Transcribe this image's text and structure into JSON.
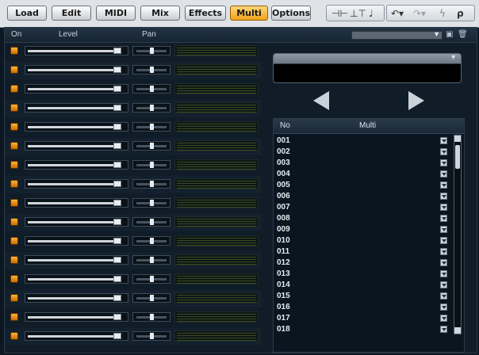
{
  "toolbar": {
    "tabs": [
      {
        "label": "Load"
      },
      {
        "label": "Edit"
      },
      {
        "label": "MIDI"
      },
      {
        "label": "Mix"
      },
      {
        "label": "Effects"
      },
      {
        "label": "Multi",
        "active": true
      },
      {
        "label": "Options"
      }
    ],
    "icons": [
      "split-icon",
      "merge-icon",
      "note-icon",
      "undo-icon",
      "redo-icon",
      "flash-icon",
      "pin-icon"
    ]
  },
  "mixer": {
    "headers": {
      "on": "On",
      "level": "Level",
      "pan": "Pan"
    },
    "channel_count": 16,
    "level_fraction": 0.94,
    "pan_fraction": 0.5,
    "on_color": "#f0a21a"
  },
  "preset": {
    "value": ""
  },
  "multi_select": {
    "value": ""
  },
  "list": {
    "headers": {
      "no": "No",
      "multi": "Multi"
    },
    "items": [
      "001",
      "002",
      "003",
      "004",
      "005",
      "006",
      "007",
      "008",
      "009",
      "010",
      "011",
      "012",
      "013",
      "014",
      "015",
      "016",
      "017",
      "018"
    ]
  }
}
